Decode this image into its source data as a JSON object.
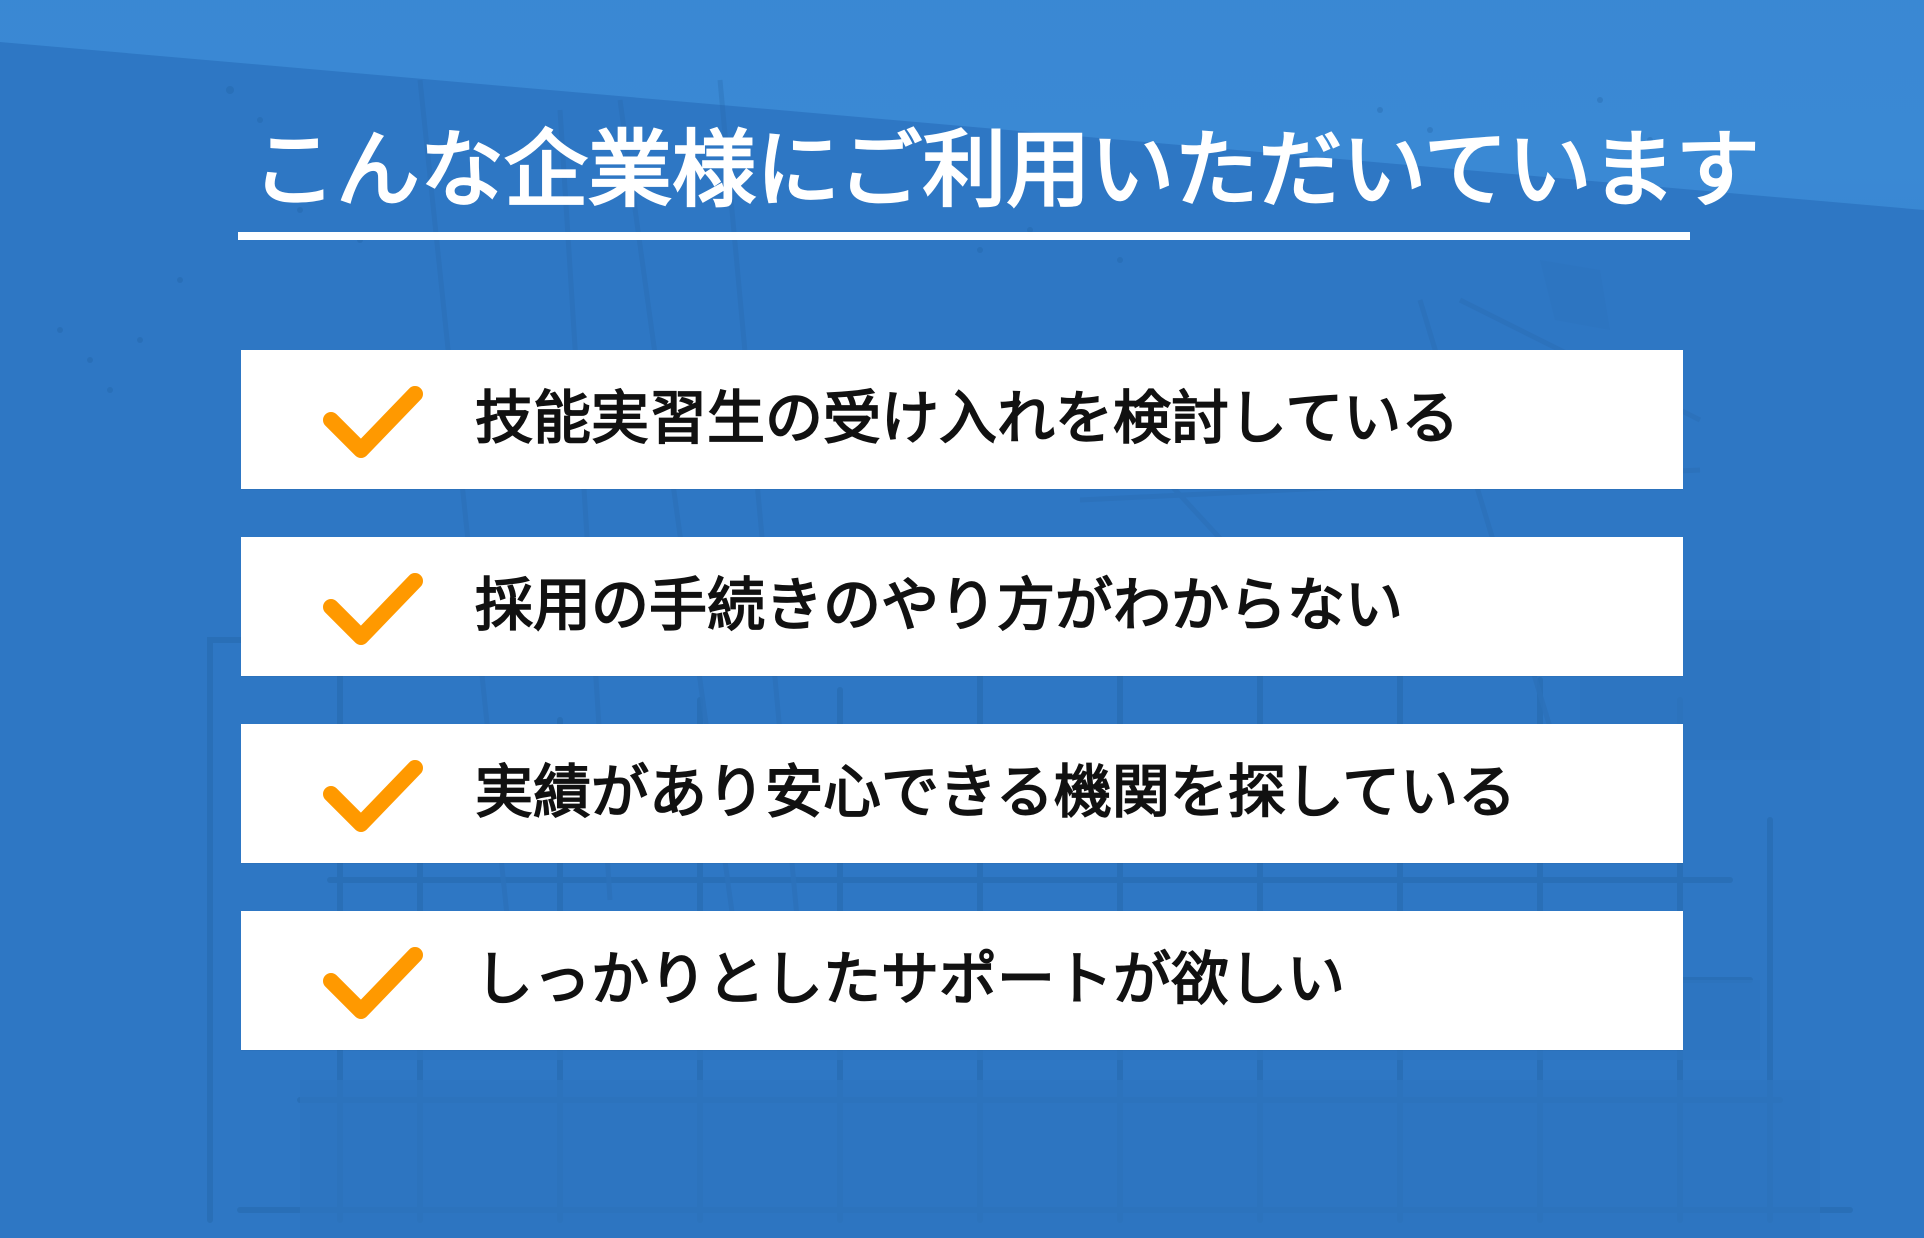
{
  "page": {
    "title": "こんな企業様にご利用いただいています"
  },
  "theme": {
    "background": "#2e77c4",
    "accent": "#ff9900",
    "card": "#ffffff",
    "text": "#111111"
  },
  "checklist": [
    {
      "icon": "check-icon",
      "text": "技能実習生の受け入れを検討している"
    },
    {
      "icon": "check-icon",
      "text": "採用の手続きのやり方がわからない"
    },
    {
      "icon": "check-icon",
      "text": "実績があり安心できる機関を探している"
    },
    {
      "icon": "check-icon",
      "text": "しっかりとしたサポートが欲しい"
    }
  ]
}
